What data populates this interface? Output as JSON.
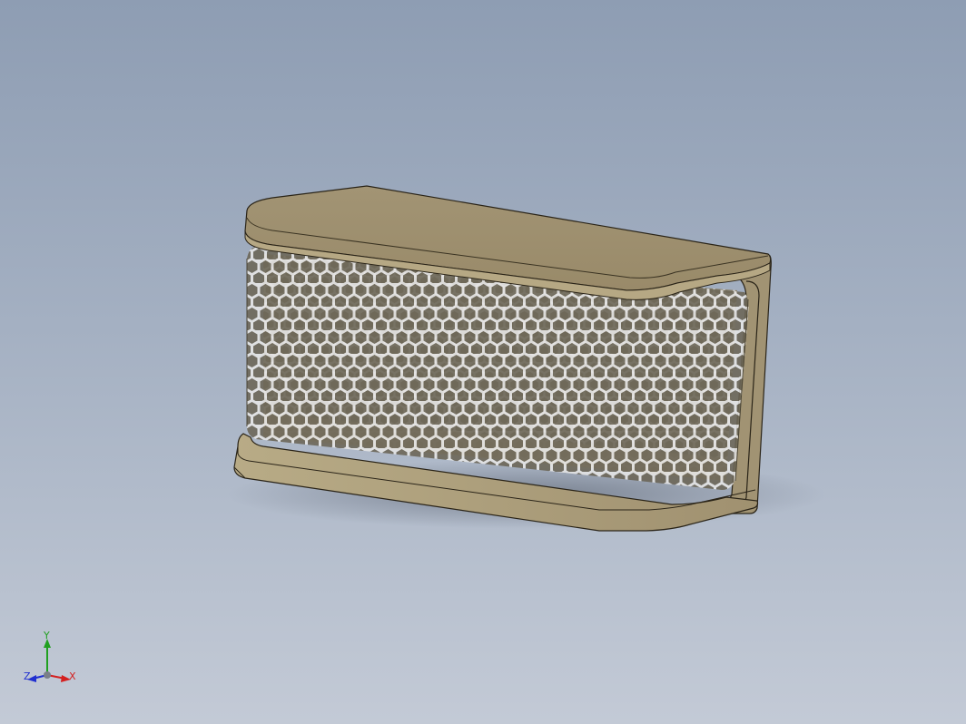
{
  "viewport": {
    "background_top": "#8e9db3",
    "background_bottom": "#c3cad6"
  },
  "model": {
    "body_color": "#a89a78",
    "top_face_color": "#a29474",
    "edge_color": "#2a2418",
    "mesh_pattern": "hexagonal"
  },
  "triad": {
    "x_label": "X",
    "y_label": "Y",
    "z_label": "Z",
    "x_color": "#d42020",
    "y_color": "#20a020",
    "z_color": "#2030d0"
  }
}
